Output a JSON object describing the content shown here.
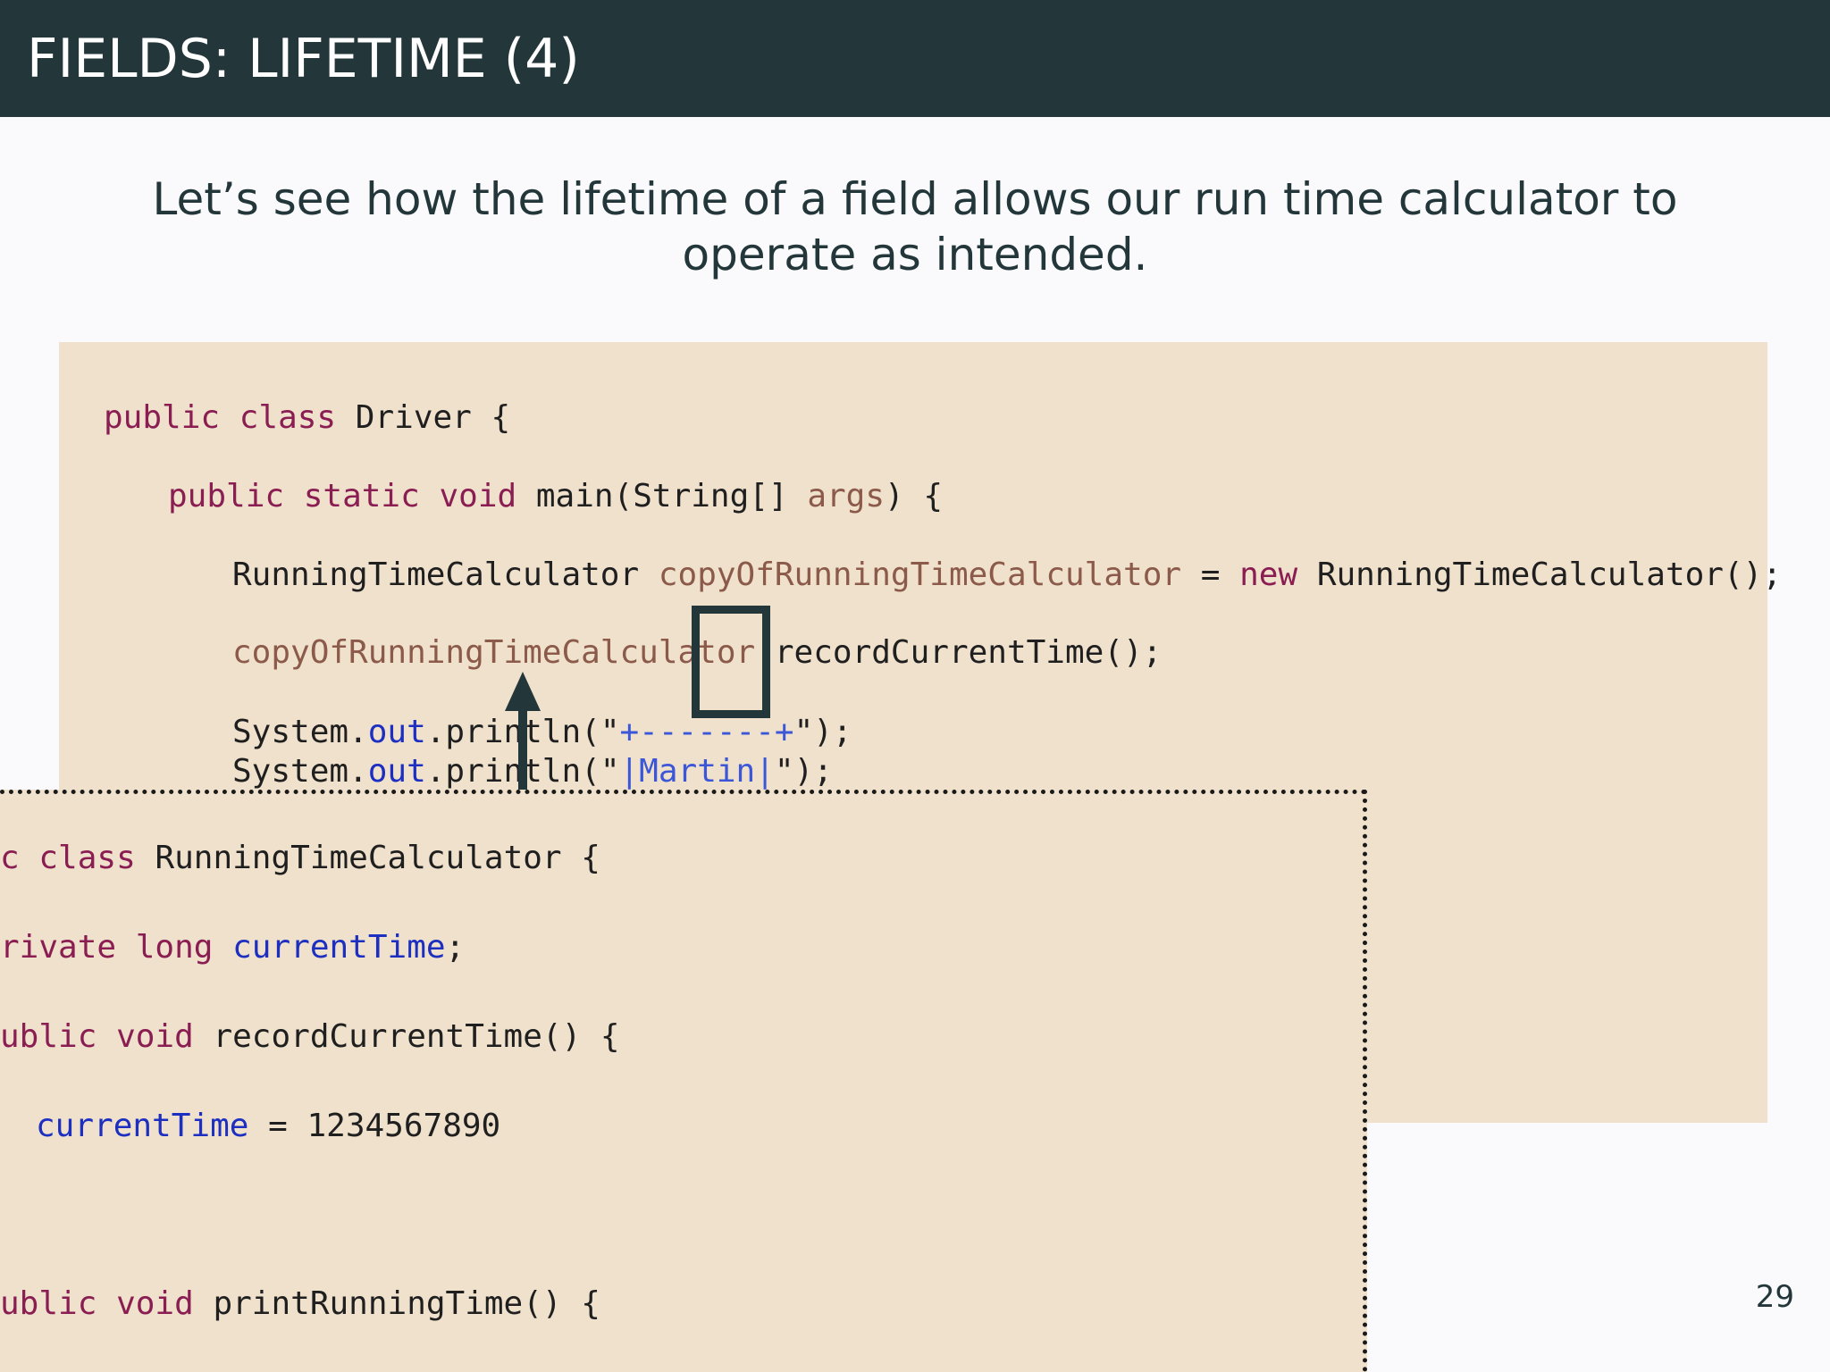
{
  "slide": {
    "title": "FIELDS: LIFETIME (4)",
    "subtitle": "Let’s see how the lifetime of a field allows our run time calculator to operate as intended.",
    "page_number": "29"
  },
  "driver_code": {
    "line1": {
      "kw1": "public",
      "kw2": "class",
      "rest": "Driver {"
    },
    "line2": {
      "kw1": "public",
      "kw2": "static",
      "kw3": "void",
      "mid": "main(String[]",
      "var": "args",
      "end": ") {"
    },
    "line3": {
      "type": "RunningTimeCalculator",
      "var": "copyOfRunningTimeCalculator",
      "eq": "=",
      "kw": "new",
      "end": "RunningTimeCalculator();"
    },
    "line4": {
      "var": "copyOfRunningTimeCalculator",
      "end": ".recordCurrentTime();"
    },
    "line5": {
      "start": "System.",
      "fld": "out",
      "mid": ".println(\"",
      "str": "+-------+",
      "end": "\");"
    },
    "line6": {
      "start": "System.",
      "fld": "out",
      "mid": ".println(\"",
      "str": "|Martin|",
      "end": "\");"
    }
  },
  "calculator_code": {
    "line1": {
      "kw1": "c",
      "kw2": "class",
      "rest": "RunningTimeCalculator {"
    },
    "line2": {
      "kw1": "rivate",
      "kw2": "long",
      "fld": "currentTime",
      "end": ";"
    },
    "line3": {
      "kw1": "ublic",
      "kw2": "void",
      "rest": "recordCurrentTime() {"
    },
    "line4": {
      "fld": "currentTime",
      "eq": "=",
      "val": "1234567890"
    },
    "line5": {
      "kw1": "ublic",
      "kw2": "void",
      "rest": "printRunningTime() {"
    }
  },
  "colors": {
    "header": "#23373b",
    "code_background": "#efe1cc",
    "keyword": "#8a1d52",
    "variable": "#8b5a4a",
    "field": "#1c2fc0",
    "string": "#3b57d8"
  }
}
